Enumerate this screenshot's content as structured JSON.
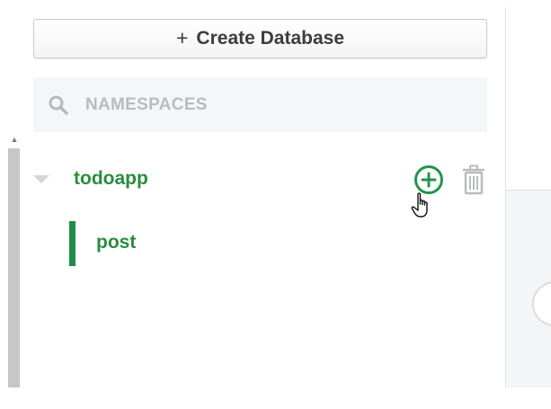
{
  "sidebar": {
    "create_button": {
      "icon": "plus-icon",
      "plus_glyph": "+",
      "label": "Create Database"
    },
    "search": {
      "icon": "search-icon",
      "placeholder": "NAMESPACES",
      "value": ""
    },
    "tree": {
      "database": {
        "name": "todoapp",
        "expanded": true,
        "actions": {
          "add_collection_icon": "plus-circle-icon",
          "delete_icon": "trash-icon"
        },
        "collections": [
          {
            "name": "post",
            "selected": true
          }
        ]
      }
    }
  },
  "colors": {
    "accent_green": "#22954a",
    "text_green": "#2a8c3f",
    "placeholder_gray": "#b6bcc0"
  }
}
